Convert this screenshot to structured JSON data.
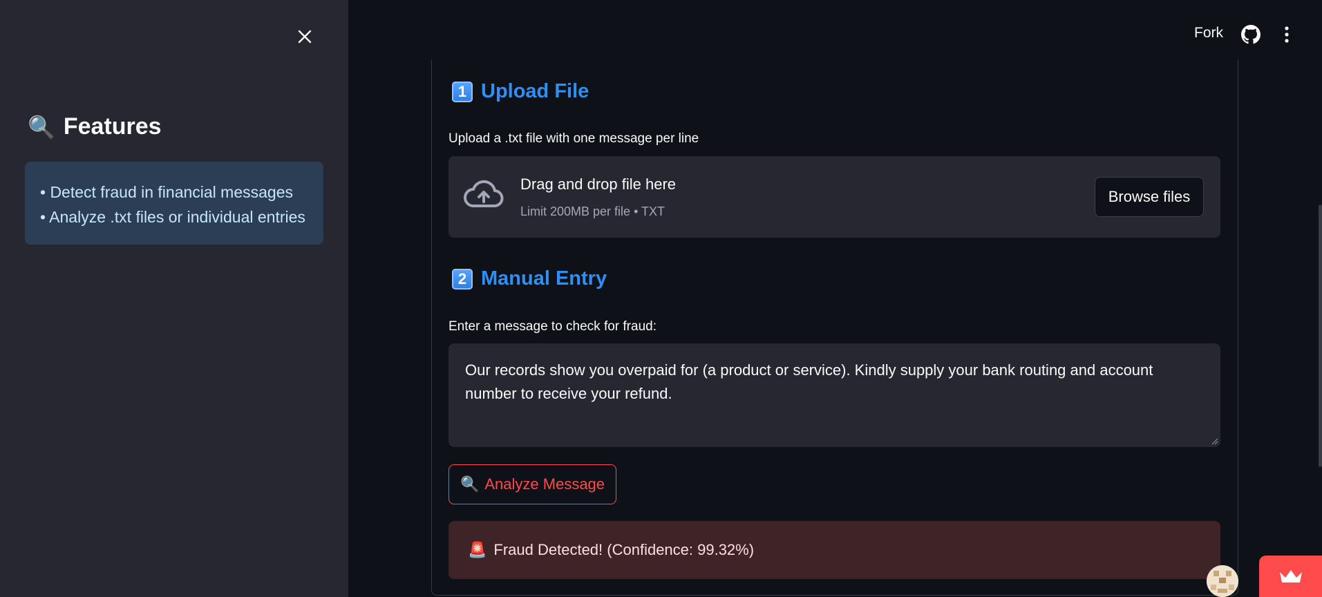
{
  "sidebar": {
    "heading_emoji": "🔍",
    "heading": "Features",
    "features": [
      "• Detect fraud in financial messages",
      "• Analyze .txt files or individual entries"
    ]
  },
  "topbar": {
    "fork_label": "Fork",
    "icons": [
      "github-icon",
      "more-vert-icon"
    ]
  },
  "upload_section": {
    "number": "1",
    "title": "Upload File",
    "label": "Upload a .txt file with one message per line",
    "dropzone_title": "Drag and drop file here",
    "dropzone_sub": "Limit 200MB per file • TXT",
    "browse_label": "Browse files"
  },
  "manual_section": {
    "number": "2",
    "title": "Manual Entry",
    "label": "Enter a message to check for fraud:",
    "message": "Our records show you overpaid for (a product or service). Kindly supply your bank routing and account number to receive your refund.",
    "analyze_emoji": "🔍",
    "analyze_label": "Analyze Message"
  },
  "result": {
    "emoji": "🚨",
    "text": "Fraud Detected! (Confidence: 99.32%)"
  },
  "colors": {
    "accent_blue": "#2f8ff5",
    "primary_red": "#ff4b4b",
    "sidebar_bg": "#262730",
    "main_bg": "#0e1117",
    "feature_box_bg": "#2c3e55",
    "alert_bg": "#3e2327"
  }
}
